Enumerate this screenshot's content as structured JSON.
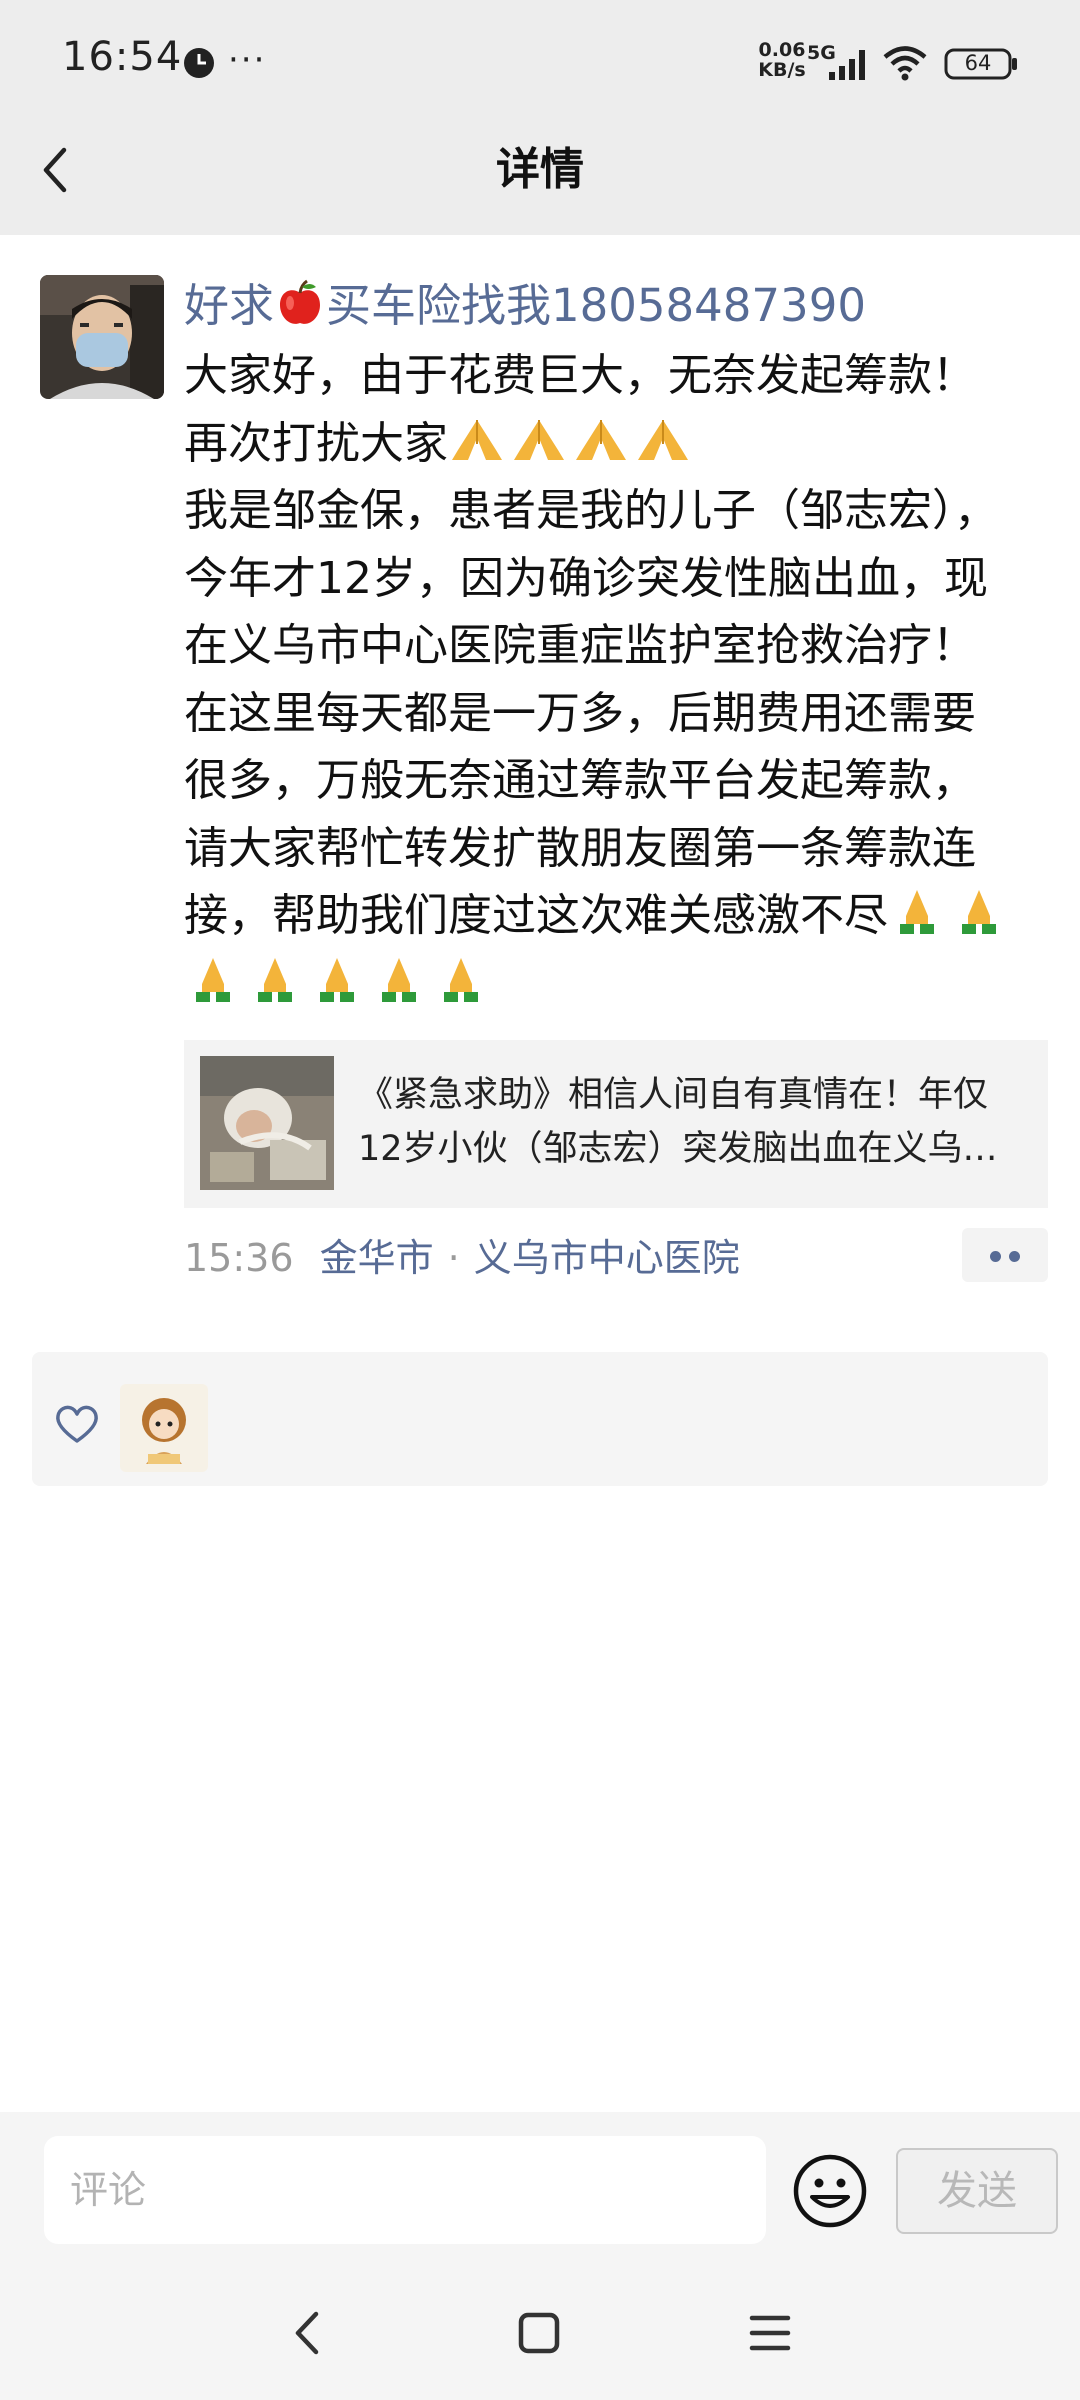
{
  "status_bar": {
    "time": "16:54",
    "more": "···",
    "net_speed_value": "0.06",
    "net_speed_unit": "KB/s",
    "network": "5G",
    "battery": "64"
  },
  "header": {
    "title": "详情",
    "back_icon": "chevron-left-icon"
  },
  "post": {
    "author_name_prefix": "好求",
    "author_name_suffix": "买车险找我18058487390",
    "text_line1": "大家好，由于花费巨大，无奈发起筹款！",
    "text_line2": "再次打扰大家",
    "text_body": "我是邹金保，患者是我的儿子（邹志宏），今年才12岁，因为确诊突发性脑出血，现在义乌市中心医院重症监护室抢救治疗！在这里每天都是一万多，后期费用还需要很多，万般无奈通过筹款平台发起筹款，请大家帮忙转发扩散朋友圈第一条筹款连接，帮助我们度过这次难关感激不尽",
    "link_title": "《紧急求助》相信人间自有真情在！年仅12岁小伙（邹志宏）突发脑出血在义乌市中心医院重症监护室抢救治疗",
    "time": "15:36",
    "city": "金华市",
    "separator": "·",
    "location": "义乌市中心医院"
  },
  "likes": {
    "icon": "heart-outline-icon"
  },
  "comment_bar": {
    "placeholder": "评论",
    "send_label": "发送",
    "emoji_icon": "smiley-icon"
  },
  "colors": {
    "link_blue": "#576b95",
    "header_bg": "#ededed"
  }
}
